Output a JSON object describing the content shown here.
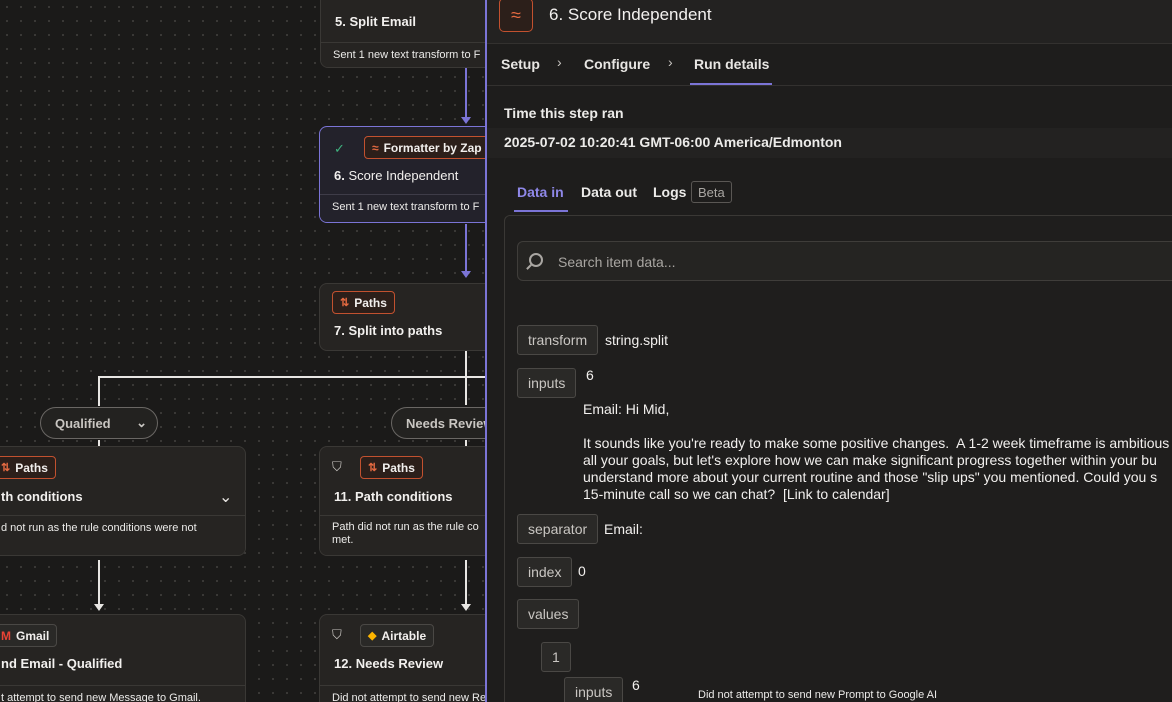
{
  "canvas": {
    "step5": {
      "num": "5.",
      "title": "Split Email",
      "footer": "Sent 1 new text transform to F"
    },
    "step6": {
      "badge": "Formatter by Zap",
      "num": "6.",
      "title": "Score Independent",
      "footer": "Sent 1 new text transform to F",
      "check": "✓"
    },
    "step7": {
      "badge": "Paths",
      "num": "7.",
      "title": "Split into paths"
    },
    "pill_qualified": "Qualified",
    "pill_needs_review": "Needs Review",
    "left_paths": {
      "badge": "Paths",
      "title": "th conditions",
      "footer": "d not run as the rule conditions were not"
    },
    "step11": {
      "badge": "Paths",
      "num": "11.",
      "title": "Path conditions",
      "footer_line1": "Path did not run as the rule co",
      "footer_line2": "met."
    },
    "left_gmail": {
      "badge": "Gmail",
      "title": "nd Email - Qualified",
      "footer": "t attempt to send new Message to Gmail."
    },
    "step12": {
      "badge": "Airtable",
      "num": "12.",
      "title": "Needs Review",
      "footer": "Did not attempt to send new Record to Airtable."
    },
    "bottom_text": "Did not attempt to send new Prompt to Google AI"
  },
  "panel": {
    "title": "6. Score Independent",
    "crumbs": [
      "Setup",
      "Configure",
      "Run details"
    ],
    "time_label": "Time this step ran",
    "timestamp": "2025-07-02 10:20:41 GMT-06:00 America/Edmonton",
    "tabs": [
      "Data in",
      "Data out",
      "Logs"
    ],
    "beta": "Beta",
    "search_placeholder": "Search item data...",
    "fields": {
      "transform_key": "transform",
      "transform_val": "string.split",
      "inputs_key": "inputs",
      "inputs_val": "6",
      "email_text": "Email: Hi Mid,\n\nIt sounds like you're ready to make some positive changes.  A 1-2 week timeframe is ambitious\nall your goals, but let's explore how we can make significant progress together within your bu\nunderstand more about your current routine and those \"slip ups\" you mentioned. Could you s\n15-minute call so we can chat?  [Link to calendar]",
      "separator_key": "separator",
      "separator_val": "Email:",
      "index_key": "index",
      "index_val": "0",
      "values_key": "values",
      "values_item": "1",
      "nested_inputs_key": "inputs",
      "nested_inputs_val": "6"
    }
  }
}
